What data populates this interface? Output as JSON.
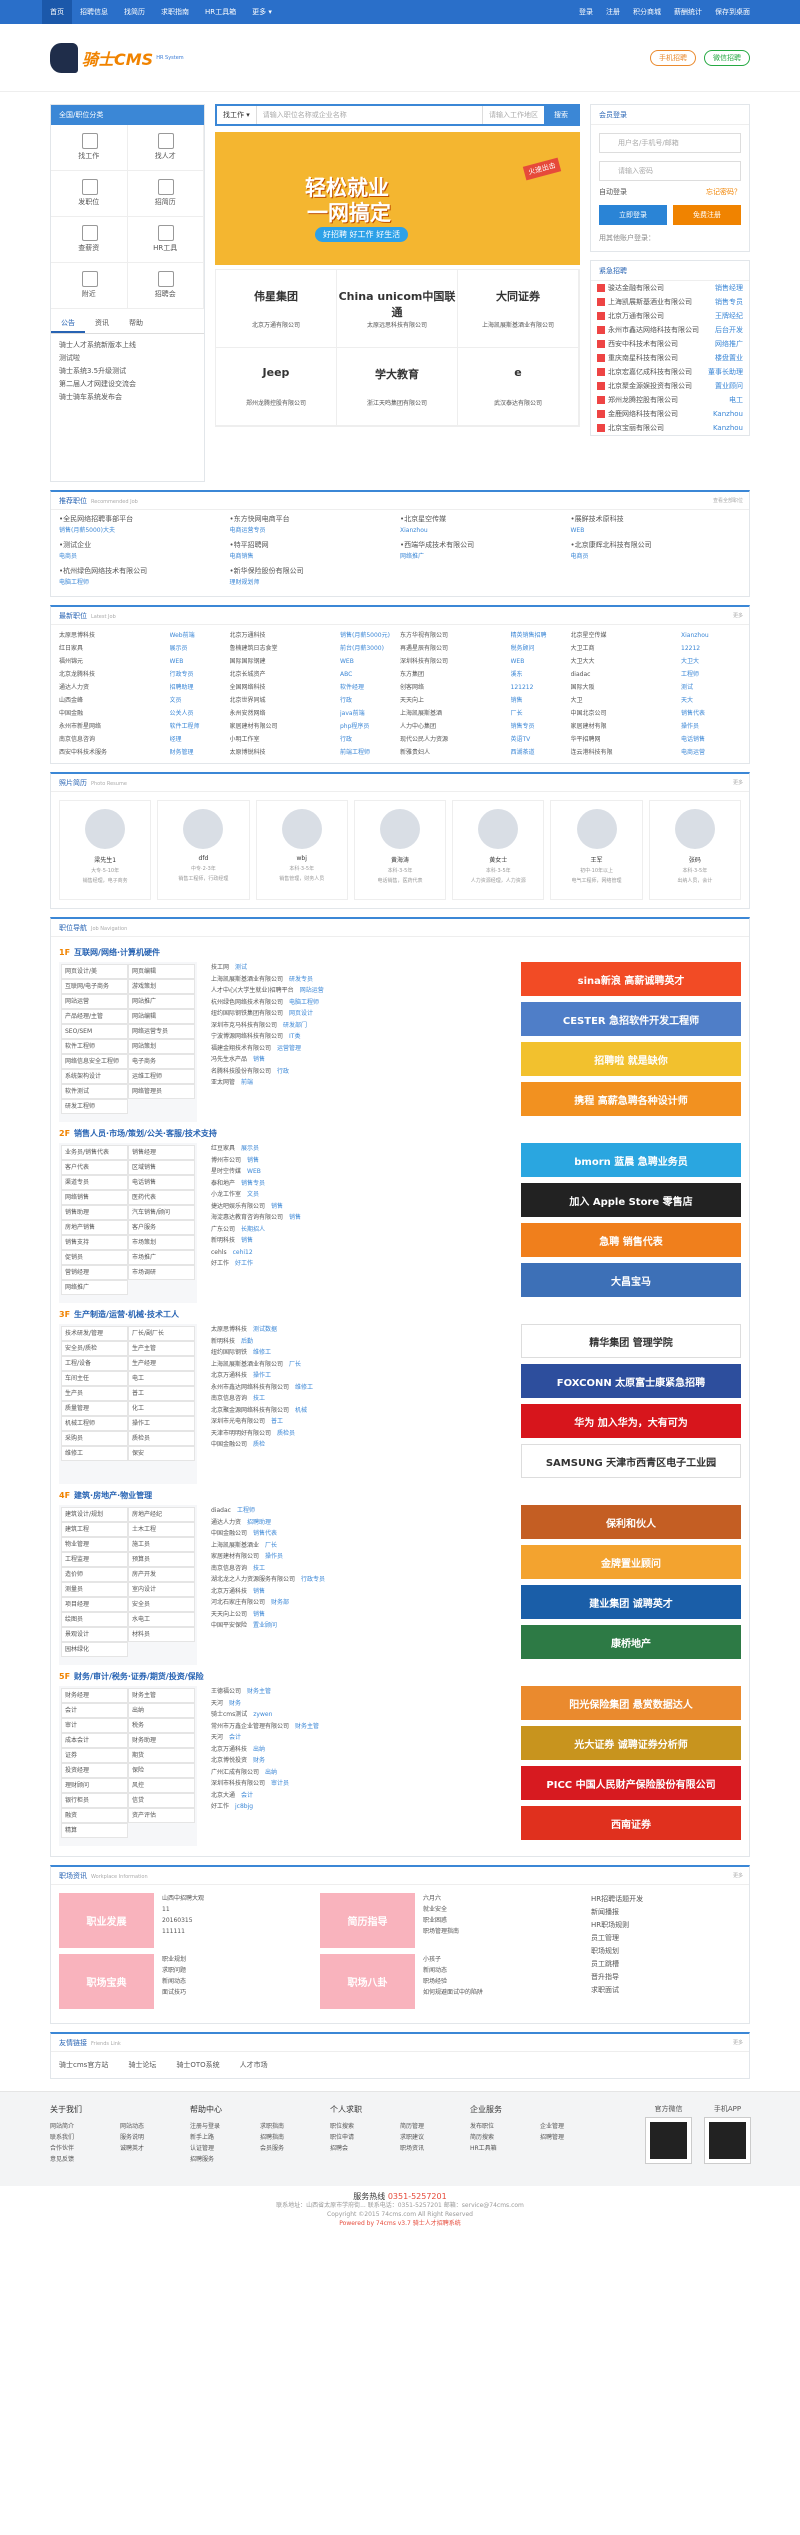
{
  "topbar": {
    "nav": [
      "首页",
      "招聘信息",
      "找简历",
      "求职指南",
      "HR工具箱",
      "更多 ▾"
    ],
    "right": [
      "登录",
      "注册",
      "积分商城",
      "薪酬统计",
      "保存到桌面"
    ]
  },
  "header": {
    "brand": "骑士CMS",
    "sub": "HR System",
    "btn_mobile": "手机招聘",
    "btn_wechat": "微信招聘"
  },
  "leftnav": {
    "title": "全国/职位分类",
    "grid": [
      "找工作",
      "找人才",
      "发职位",
      "招简历",
      "查薪资",
      "HR工具",
      "附近",
      "招聘会"
    ],
    "tabs": [
      "公告",
      "资讯",
      "帮助"
    ],
    "notices": [
      "骑士人才系统新版本上线",
      "测试啦",
      "骑士系统3.5升级测试",
      "第二届人才网建设交流会",
      "骑士骑车系统发布会"
    ]
  },
  "search": {
    "type": "找工作 ▾",
    "placeholder": "请输入职位名称或企业名称",
    "area": "请输入工作地区",
    "btn": "搜索"
  },
  "banner": {
    "l1": "轻松就业",
    "l2": "一网搞定",
    "l3": "好招聘  好工作  好生活",
    "tag": "火速出击"
  },
  "companies": [
    {
      "logo": "伟星集团",
      "name": "北京万通有限公司"
    },
    {
      "logo": "China unicom中国联通",
      "name": "太原远思科技有限公司"
    },
    {
      "logo": "大同证券",
      "name": "上海凯展斯基酒业有限公司"
    },
    {
      "logo": "Jeep",
      "name": "郑州龙腾控股有限公司"
    },
    {
      "logo": "学大教育",
      "name": "浙江天鸣集团有限公司"
    },
    {
      "logo": "e",
      "name": "武汉泰达有限公司"
    }
  ],
  "login": {
    "title": "会员登录",
    "user": "用户名/手机号/邮箱",
    "pass": "请输入密码",
    "auto": "自动登录",
    "forgot": "忘记密码？",
    "btn_login": "立即登录",
    "btn_reg": "免费注册",
    "other": "用其他账户登录："
  },
  "urgent": {
    "title": "紧急招聘",
    "more": "更多",
    "rows": [
      [
        "骏达金融有限公司",
        "销售经理"
      ],
      [
        "上海凯展斯基酒业有限公司",
        "销售专员"
      ],
      [
        "北京万通有限公司",
        "王牌经纪"
      ],
      [
        "永州市鑫达网络科技有限公司",
        "后台开发"
      ],
      [
        "西安中科技术有限公司",
        "网络推广"
      ],
      [
        "重庆南星科技有限公司",
        "楼盘置业"
      ],
      [
        "北京宏嘉亿成科技有限公司",
        "董事长助理"
      ],
      [
        "北京聚金源娱投资有限公司",
        "置业顾问"
      ],
      [
        "郑州龙腾控股有限公司",
        "电工"
      ],
      [
        "金鹿网络科技有限公司",
        "Kanzhou"
      ],
      [
        "北京宝丽有限公司",
        "Kanzhou"
      ]
    ]
  },
  "recommend": {
    "title": "推荐职位",
    "en": "Recommended Job",
    "more": "查看全部职位",
    "items": [
      [
        "•全民网络招聘事部平台",
        "销售(月薪5000)大夫"
      ],
      [
        "•东方快网电商平台",
        "电商运营专员"
      ],
      [
        "•北京星空传媒",
        "Xianzhou"
      ],
      [
        "•展鲜技术原科技",
        "WEB"
      ],
      [
        "•测试企业",
        "电商员"
      ],
      [
        "•特平招聘网",
        "电商销售"
      ],
      [
        "•西端华成技术有限公司",
        "网络推广"
      ],
      [
        "•北京康辉北科技有限公司",
        "电商员"
      ],
      [
        "•杭州绿色网络技术有限公司",
        "电脑工程师"
      ],
      [
        "•新华保险股份有限公司",
        "理财规划师"
      ]
    ]
  },
  "newjobs": {
    "title": "最新职位",
    "en": "Latest Job",
    "more": "更多",
    "rows": [
      [
        "太原思博科技",
        "Web前端"
      ],
      [
        "北京万通科技",
        "销售(月薪5000元)"
      ],
      [
        "东方华视有限公司",
        "精英销售招聘"
      ],
      [
        "北京星空传媒",
        "Xianzhou"
      ],
      [
        "红日家具",
        "展示员"
      ],
      [
        "鲁楠建筑日志食堂",
        "前台(月薪3000)"
      ],
      [
        "再遇星辰有限公司",
        "税务顾问"
      ],
      [
        "大卫工商",
        "12212"
      ],
      [
        "福州锦元",
        "WEB"
      ],
      [
        "国际国际钢建",
        "WEB"
      ],
      [
        "深圳科技有限公司",
        "WEB"
      ],
      [
        "大卫大大",
        "大卫大"
      ],
      [
        "北京龙腾科技",
        "行政专员"
      ],
      [
        "北京长城资产",
        "ABC"
      ],
      [
        "东方集团",
        "溪东"
      ],
      [
        "diadac",
        "工程师"
      ],
      [
        "通达人力资",
        "招聘助理"
      ],
      [
        "全国网络科技",
        "软件经理"
      ],
      [
        "创客网络",
        "121212"
      ],
      [
        "国际大阪",
        "测试"
      ],
      [
        "山西金峰",
        "文员"
      ],
      [
        "北京世界同城",
        "行政"
      ],
      [
        "天天向上",
        "销售"
      ],
      [
        "大卫",
        "天大"
      ],
      [
        "中国金融",
        "公关人员"
      ],
      [
        "永州安然网络",
        "java前端"
      ],
      [
        "上海凯展斯基酒",
        "厂长"
      ],
      [
        "中国北京公司",
        "销售代表"
      ],
      [
        "永州市新星网络",
        "软件工程师"
      ],
      [
        "家居建材有限公司",
        "php程序员"
      ],
      [
        "人力中心集团",
        "销售专员"
      ],
      [
        "家居建材有限",
        "操作员"
      ],
      [
        "南京信息咨询",
        "经理"
      ],
      [
        "小明工作室",
        "行政"
      ],
      [
        "现代公民人力资源",
        "英语TV"
      ],
      [
        "华平招聘网",
        "电话销售"
      ],
      [
        "西安中科技术服务",
        "财务管理"
      ],
      [
        "太原博锐科技",
        "前端工程师"
      ],
      [
        "新雅贵妇人",
        "西湖茶道"
      ],
      [
        "连云港科技有限",
        "电商运营"
      ]
    ]
  },
  "photos": {
    "title": "照片简历",
    "en": "Photo Resume",
    "more": "更多",
    "items": [
      [
        "梁先生1",
        "大专·5-10年",
        "销售经理，电子商务"
      ],
      [
        "dfd",
        "中专·2-3年",
        "销售工程师，行政经理"
      ],
      [
        "wbj",
        "本科·3-5年",
        "销售管理，财务人员"
      ],
      [
        "黄海涛",
        "本科·3-5年",
        "电话销售，医药代表"
      ],
      [
        "黄女士",
        "本科·3-5年",
        "人力资源经理，人力资源"
      ],
      [
        "王军",
        "初中·10年以上",
        "电气工程师，网络管理"
      ],
      [
        "张码",
        "本科·3-5年",
        "出纳人员，会计"
      ]
    ]
  },
  "category": {
    "title": "职位导航",
    "en": "Job Navigation",
    "groups": [
      {
        "num": "1F",
        "name": "互联网/网络·计算机硬件",
        "tags": [
          "网页设计/美",
          "网页编辑",
          "互联网/电子商务",
          "游戏策划",
          "网站运营",
          "网站推广",
          "产品经理/主管",
          "网站编辑",
          "SEO/SEM",
          "网络运营专员",
          "软件工程师",
          "网站策划",
          "网络信息安全工程师",
          "电子商务",
          "系统架构设计",
          "运维工程师",
          "软件测试",
          "网络管理员",
          "研发工程师"
        ],
        "list": [
          [
            "技工网",
            "测试"
          ],
          [
            "上海凯展斯基酒业有限公司",
            "研发专员"
          ],
          [
            "人才中心(大学生就业)招聘平台",
            "网站运营"
          ],
          [
            "杭州绿色网络技术有限公司",
            "电脑工程师"
          ],
          [
            "纽约国际钢铁集团有限公司",
            "网页设计"
          ],
          [
            "深圳市克马科技有限公司",
            "研发部门"
          ],
          [
            "宁波博源网络科技有限公司",
            "IT类"
          ],
          [
            "福建金翔技术有限公司",
            "运营管理"
          ],
          [
            "冯先生水产品",
            "销售"
          ],
          [
            "名腾科技股份有限公司",
            "行政"
          ],
          [
            "亚太网管",
            "前端"
          ]
        ],
        "ads": [
          {
            "t": "sina新浪 高薪诚聘英才",
            "c": "#f24b25"
          },
          {
            "t": "CESTER 急招软件开发工程师",
            "c": "#4f7ec8"
          },
          {
            "t": "招聘啦 就是缺你",
            "c": "#f2c12e"
          },
          {
            "t": "携程 高薪急聘各种设计师",
            "c": "#f29120"
          }
        ]
      },
      {
        "num": "2F",
        "name": "销售人员·市场/策划/公关·客服/技术支持",
        "tags": [
          "业务员/销售代表",
          "销售经理",
          "客户代表",
          "区域销售",
          "渠道专员",
          "电话销售",
          "网络销售",
          "医药代表",
          "销售助理",
          "汽车销售/顾问",
          "房地产销售",
          "客户服务",
          "销售支持",
          "市场策划",
          "促销员",
          "市场推广",
          "营销经理",
          "市场调研",
          "网络推广"
        ],
        "list": [
          [
            "红豆家具",
            "展示员"
          ],
          [
            "博州市公司",
            "销售"
          ],
          [
            "星时空传媒",
            "WEB"
          ],
          [
            "泰和地产",
            "销售专员"
          ],
          [
            "小龙工作室",
            "文员"
          ],
          [
            "捷达吧娱乐有限公司",
            "销售"
          ],
          [
            "海淀惠达教育咨询有限公司",
            "销售"
          ],
          [
            "广东公司",
            "长期招人"
          ],
          [
            "新明科技",
            "销售"
          ],
          [
            "cehls",
            "cehi12"
          ],
          [
            "好工作",
            "好工作"
          ]
        ],
        "ads": [
          {
            "t": "bmorn 蓝晨 急聘业务员",
            "c": "#2aa6e0"
          },
          {
            "t": "加入 Apple Store 零售店",
            "c": "#222222"
          },
          {
            "t": "急聘 销售代表",
            "c": "#f07f1c"
          },
          {
            "t": "大昌宝马",
            "c": "#3d70b7"
          }
        ]
      },
      {
        "num": "3F",
        "name": "生产制造/运营·机械·技术工人",
        "tags": [
          "技术研发/管理",
          "厂长/副厂长",
          "安全员/质检",
          "生产主管",
          "工程/设备",
          "生产经理",
          "车间主任",
          "电工",
          "生产员",
          "普工",
          "质量管理",
          "化工",
          "机械工程师",
          "操作工",
          "采购员",
          "质检员",
          "维修工",
          "保安"
        ],
        "list": [
          [
            "太原思博科技",
            "测试数据"
          ],
          [
            "新明科技",
            "后勤"
          ],
          [
            "纽约国际钢铁",
            "维修工"
          ],
          [
            "上海凯展斯基酒业有限公司",
            "厂长"
          ],
          [
            "北京万通科技",
            "操作工"
          ],
          [
            "永州市鑫达网络科技有限公司",
            "维修工"
          ],
          [
            "南京信息咨询",
            "技工"
          ],
          [
            "北京聚金源网络科技有限公司",
            "机械"
          ],
          [
            "深圳市光电有限公司",
            "普工"
          ],
          [
            "天津市明明好有限公司",
            "质检员"
          ],
          [
            "中国金融公司",
            "质检"
          ]
        ],
        "ads": [
          {
            "t": "精华集团 管理学院",
            "c": "#ffffff"
          },
          {
            "t": "FOXCONN 太原富士康紧急招聘",
            "c": "#2d4e9d"
          },
          {
            "t": "华为 加入华为，大有可为",
            "c": "#d7151c"
          },
          {
            "t": "SAMSUNG 天津市西青区电子工业园",
            "c": "#ffffff"
          }
        ]
      },
      {
        "num": "4F",
        "name": "建筑·房地产·物业管理",
        "tags": [
          "建筑设计/规划",
          "房地产经纪",
          "建筑工程",
          "土木工程",
          "物业管理",
          "施工员",
          "工程监理",
          "预算员",
          "造价师",
          "房产开发",
          "测量员",
          "室内设计",
          "项目经理",
          "安全员",
          "绘图员",
          "水电工",
          "景观设计",
          "材料员",
          "园林绿化"
        ],
        "list": [
          [
            "diadac",
            "工程师"
          ],
          [
            "通达人力资",
            "招聘助理"
          ],
          [
            "中国金融公司",
            "销售代表"
          ],
          [
            "上海凯展斯基酒业",
            "厂长"
          ],
          [
            "家居建材有限公司",
            "操作员"
          ],
          [
            "南京信息咨询",
            "技工"
          ],
          [
            "湖北龙之人力资源服务有限公司",
            "行政专员"
          ],
          [
            "北京万通科技",
            "销售"
          ],
          [
            "河北石家庄有限公司",
            "财务部"
          ],
          [
            "天天向上公司",
            "销售"
          ],
          [
            "中国平安保险",
            "置业顾问"
          ]
        ],
        "ads": [
          {
            "t": "保利和伙人",
            "c": "#c45e23"
          },
          {
            "t": "金牌置业顾问",
            "c": "#f3a32f"
          },
          {
            "t": "建业集团 诚聘英才",
            "c": "#1a5ea8"
          },
          {
            "t": "康桥地产",
            "c": "#2d7a45"
          }
        ]
      },
      {
        "num": "5F",
        "name": "财务/审计/税务·证券/期货/投资/保险",
        "tags": [
          "财务经理",
          "财务主管",
          "会计",
          "出纳",
          "审计",
          "税务",
          "成本会计",
          "财务助理",
          "证券",
          "期货",
          "投资经理",
          "保险",
          "理财顾问",
          "风控",
          "银行柜员",
          "信贷",
          "融资",
          "资产评估",
          "精算"
        ],
        "list": [
          [
            "王德福公司",
            "财务主管"
          ],
          [
            "天河",
            "财务"
          ],
          [
            "骑士cms测试",
            "zywen"
          ],
          [
            "常州市万鑫企业管理有限公司",
            "财务主管"
          ],
          [
            "天河",
            "会计"
          ],
          [
            "北京万通科技",
            "出纳"
          ],
          [
            "北京博悦投资",
            "财务"
          ],
          [
            "广州汇成有限公司",
            "出纳"
          ],
          [
            "深圳市科技有限公司",
            "审计员"
          ],
          [
            "北京大通",
            "会计"
          ],
          [
            "好工作",
            "jc8bjg"
          ]
        ],
        "ads": [
          {
            "t": "阳光保险集团 悬赏数据达人",
            "c": "#ea8a2e"
          },
          {
            "t": "光大证券 诚聘证券分析师",
            "c": "#c8941e"
          },
          {
            "t": "PICC 中国人民财产保险股份有限公司",
            "c": "#d71a20"
          },
          {
            "t": "西南证券",
            "c": "#e0301e"
          }
        ]
      }
    ]
  },
  "news": {
    "title": "职场资讯",
    "en": "Workplace Information",
    "more": "更多",
    "blocks": [
      {
        "pic": "职业发展",
        "items": [
          "山西中招聘大观",
          "11",
          "20160315",
          "111111"
        ]
      },
      {
        "pic": "简历指导",
        "items": [
          "六月六",
          "就业安全",
          "职业困惑",
          "职场管理指南"
        ]
      },
      {
        "pic": "职场宝典",
        "items": [
          "职业规划",
          "求职问题",
          "新闻动态",
          "面试技巧"
        ]
      },
      {
        "pic": "职场八卦",
        "items": [
          "小孩子",
          "新闻动态",
          "职场经验",
          "如何规避面试中的陷阱"
        ]
      }
    ],
    "side": [
      "HR招聘话题开发",
      "新闻播报",
      "HR职场规则",
      "员工管理",
      "职场规划",
      "员工跳槽",
      "晋升指导",
      "求职面试"
    ]
  },
  "links": {
    "title": "友情链接",
    "en": "Friends Link",
    "more": "更多",
    "items": [
      "骑士cms官方站",
      "骑士论坛",
      "骑士OTO系统",
      "人才市场"
    ]
  },
  "footer": {
    "cols": [
      {
        "h": "关于我们",
        "a": [
          "网站简介",
          "网站动态",
          "联系我们",
          "服务说明",
          "合作伙伴",
          "诚聘英才",
          "意见反馈"
        ]
      },
      {
        "h": "帮助中心",
        "a": [
          "注册与登录",
          "求职指南",
          "新手上路",
          "招聘指南",
          "认证管理",
          "会员服务",
          "招聘服务"
        ]
      },
      {
        "h": "个人求职",
        "a": [
          "职位搜索",
          "简历管理",
          "职位申请",
          "求职建议",
          "招聘会",
          "职场资讯"
        ]
      },
      {
        "h": "企业服务",
        "a": [
          "发布职位",
          "企业管理",
          "简历搜索",
          "招聘管理",
          "HR工具箱"
        ]
      }
    ],
    "qr1": "官方微信",
    "qr2": "手机APP",
    "hotline_label": "服务热线",
    "hotline": "0351-5257201",
    "copy1": "联系地址：山西省太原市学府街...  联系电话：0351-5257201  邮箱：service@74cms.com",
    "copy2": "Copyright ©2015 74cms.com All Right Reserved",
    "copy3": "Powered by 74cms v3.7 骑士人才招聘系统"
  }
}
